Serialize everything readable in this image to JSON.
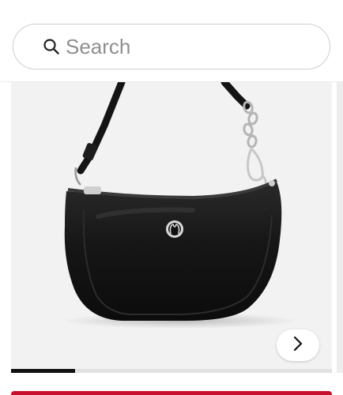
{
  "search": {
    "placeholder": "Search",
    "value": ""
  },
  "icons": {
    "search": "search-icon",
    "next": "chevron-right-icon",
    "brand_logo": "lululemon-logo-icon"
  },
  "carousel": {
    "progress": 0.2
  },
  "colors": {
    "cta": "#c8102e",
    "progress_fill": "#111111",
    "image_background": "#f2f2f2"
  }
}
